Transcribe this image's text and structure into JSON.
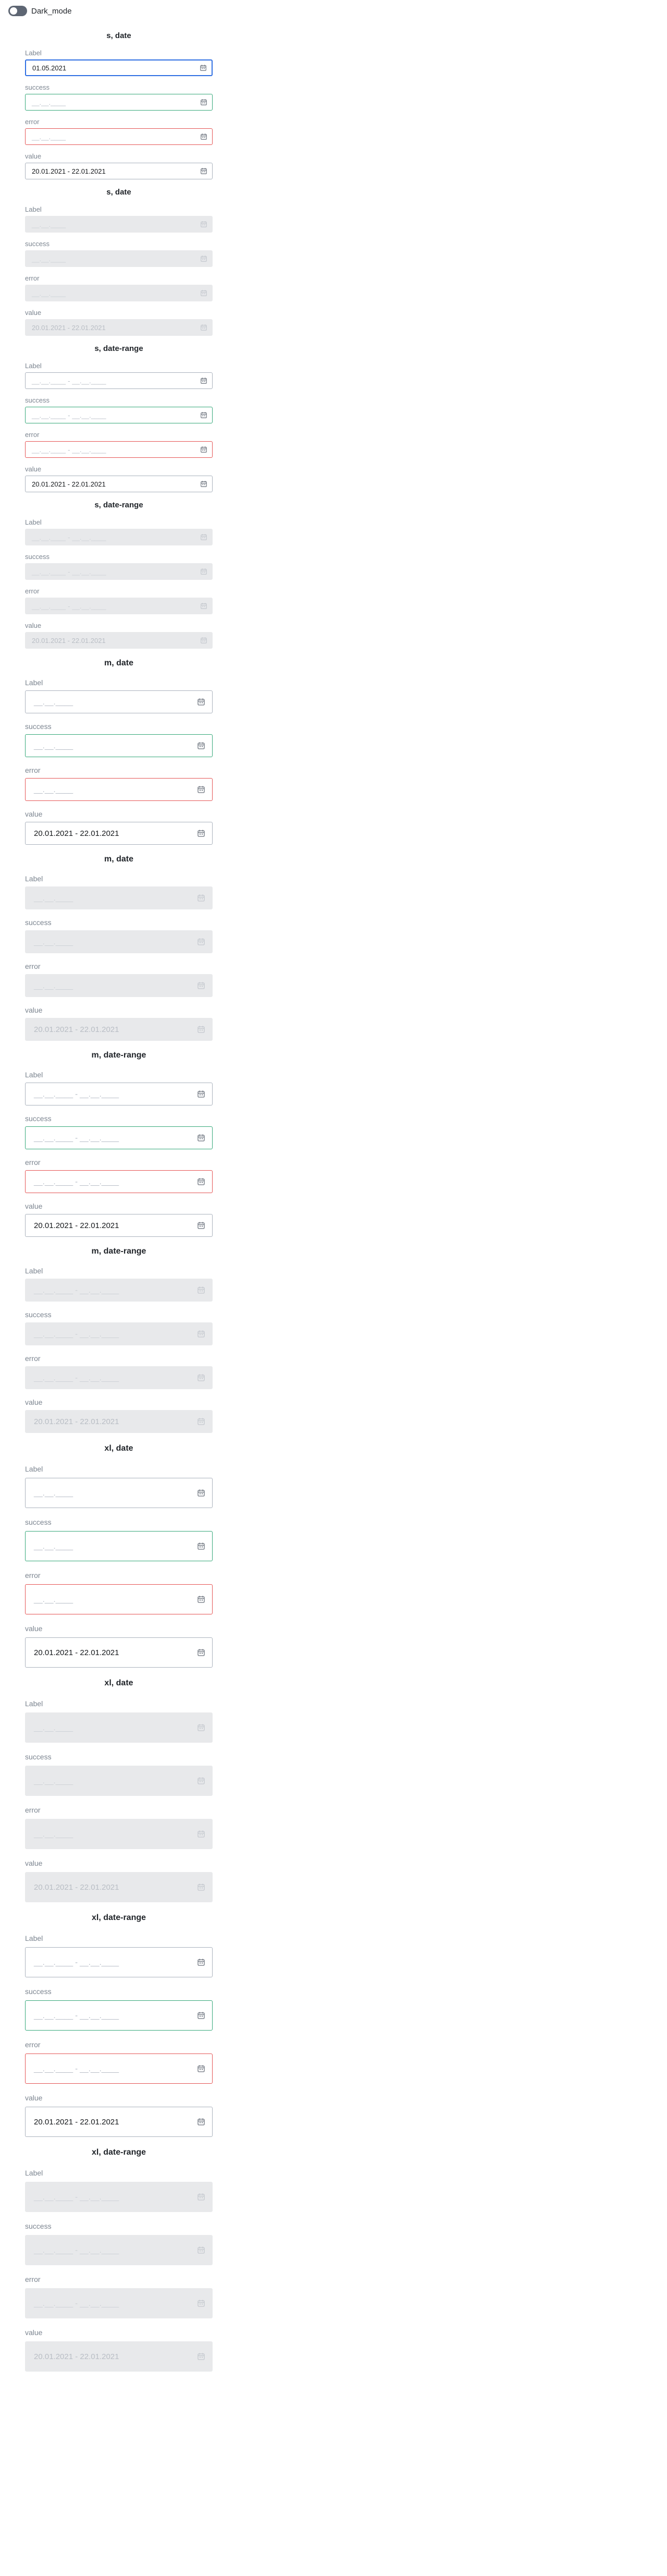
{
  "header": {
    "toggle_label": "Dark_mode",
    "toggle_on": false
  },
  "colors": {
    "focus": "#2f6fe3",
    "success": "#35a879",
    "error": "#e55454",
    "disabled_bg": "#e8e9eb",
    "label": "#7c8590"
  },
  "icons": {
    "calendar": "calendar-icon",
    "toggle": "toggle-switch"
  },
  "groups": [
    {
      "title": "s, date",
      "size": "s",
      "mode": "date",
      "disabled": false,
      "fields": [
        {
          "label": "Label",
          "status": "focused",
          "value": "01.05.2021",
          "placeholder": "__.__.____"
        },
        {
          "label": "success",
          "status": "success",
          "value": "",
          "placeholder": "__.__.____"
        },
        {
          "label": "error",
          "status": "error",
          "value": "",
          "placeholder": "__.__.____"
        },
        {
          "label": "value",
          "status": "default",
          "value": "20.01.2021 - 22.01.2021",
          "placeholder": ""
        }
      ]
    },
    {
      "title": "s, date",
      "size": "s",
      "mode": "date",
      "disabled": true,
      "fields": [
        {
          "label": "Label",
          "status": "default",
          "value": "",
          "placeholder": "__.__.____"
        },
        {
          "label": "success",
          "status": "default",
          "value": "",
          "placeholder": "__.__.____"
        },
        {
          "label": "error",
          "status": "default",
          "value": "",
          "placeholder": "__.__.____"
        },
        {
          "label": "value",
          "status": "default",
          "value": "20.01.2021 - 22.01.2021",
          "placeholder": ""
        }
      ]
    },
    {
      "title": "s, date-range",
      "size": "s",
      "mode": "range",
      "disabled": false,
      "fields": [
        {
          "label": "Label",
          "status": "default",
          "value": "",
          "placeholder": "__.__.____"
        },
        {
          "label": "success",
          "status": "success",
          "value": "",
          "placeholder": "__.__.____"
        },
        {
          "label": "error",
          "status": "error",
          "value": "",
          "placeholder": "__.__.____"
        },
        {
          "label": "value",
          "status": "default",
          "value": "20.01.2021 - 22.01.2021",
          "placeholder": ""
        }
      ]
    },
    {
      "title": "s, date-range",
      "size": "s",
      "mode": "range",
      "disabled": true,
      "fields": [
        {
          "label": "Label",
          "status": "default",
          "value": "",
          "placeholder": "__.__.____"
        },
        {
          "label": "success",
          "status": "default",
          "value": "",
          "placeholder": "__.__.____"
        },
        {
          "label": "error",
          "status": "default",
          "value": "",
          "placeholder": "__.__.____"
        },
        {
          "label": "value",
          "status": "default",
          "value": "20.01.2021 - 22.01.2021",
          "placeholder": ""
        }
      ]
    },
    {
      "title": "m, date",
      "size": "m",
      "mode": "date",
      "disabled": false,
      "fields": [
        {
          "label": "Label",
          "status": "default",
          "value": "",
          "placeholder": "__.__.____"
        },
        {
          "label": "success",
          "status": "success",
          "value": "",
          "placeholder": "__.__.____"
        },
        {
          "label": "error",
          "status": "error",
          "value": "",
          "placeholder": "__.__.____"
        },
        {
          "label": "value",
          "status": "default",
          "value": "20.01.2021 - 22.01.2021",
          "placeholder": ""
        }
      ]
    },
    {
      "title": "m, date",
      "size": "m",
      "mode": "date",
      "disabled": true,
      "fields": [
        {
          "label": "Label",
          "status": "default",
          "value": "",
          "placeholder": "__.__.____"
        },
        {
          "label": "success",
          "status": "default",
          "value": "",
          "placeholder": "__.__.____"
        },
        {
          "label": "error",
          "status": "default",
          "value": "",
          "placeholder": "__.__.____"
        },
        {
          "label": "value",
          "status": "default",
          "value": "20.01.2021 - 22.01.2021",
          "placeholder": ""
        }
      ]
    },
    {
      "title": "m, date-range",
      "size": "m",
      "mode": "range",
      "disabled": false,
      "fields": [
        {
          "label": "Label",
          "status": "default",
          "value": "",
          "placeholder": "__.__.____"
        },
        {
          "label": "success",
          "status": "success",
          "value": "",
          "placeholder": "__.__.____"
        },
        {
          "label": "error",
          "status": "error",
          "value": "",
          "placeholder": "__.__.____"
        },
        {
          "label": "value",
          "status": "default",
          "value": "20.01.2021 - 22.01.2021",
          "placeholder": ""
        }
      ]
    },
    {
      "title": "m, date-range",
      "size": "m",
      "mode": "range",
      "disabled": true,
      "fields": [
        {
          "label": "Label",
          "status": "default",
          "value": "",
          "placeholder": "__.__.____"
        },
        {
          "label": "success",
          "status": "default",
          "value": "",
          "placeholder": "__.__.____"
        },
        {
          "label": "error",
          "status": "default",
          "value": "",
          "placeholder": "__.__.____"
        },
        {
          "label": "value",
          "status": "default",
          "value": "20.01.2021 - 22.01.2021",
          "placeholder": ""
        }
      ]
    },
    {
      "title": "xl, date",
      "size": "xl",
      "mode": "date",
      "disabled": false,
      "fields": [
        {
          "label": "Label",
          "status": "default",
          "value": "",
          "placeholder": "__.__.____"
        },
        {
          "label": "success",
          "status": "success",
          "value": "",
          "placeholder": "__.__.____"
        },
        {
          "label": "error",
          "status": "error",
          "value": "",
          "placeholder": "__.__.____"
        },
        {
          "label": "value",
          "status": "default",
          "value": "20.01.2021 - 22.01.2021",
          "placeholder": ""
        }
      ]
    },
    {
      "title": "xl, date",
      "size": "xl",
      "mode": "date",
      "disabled": true,
      "fields": [
        {
          "label": "Label",
          "status": "default",
          "value": "",
          "placeholder": "__.__.____"
        },
        {
          "label": "success",
          "status": "default",
          "value": "",
          "placeholder": "__.__.____"
        },
        {
          "label": "error",
          "status": "default",
          "value": "",
          "placeholder": "__.__.____"
        },
        {
          "label": "value",
          "status": "default",
          "value": "20.01.2021 - 22.01.2021",
          "placeholder": ""
        }
      ]
    },
    {
      "title": "xl, date-range",
      "size": "xl",
      "mode": "range",
      "disabled": false,
      "fields": [
        {
          "label": "Label",
          "status": "default",
          "value": "",
          "placeholder": "__.__.____"
        },
        {
          "label": "success",
          "status": "success",
          "value": "",
          "placeholder": "__.__.____"
        },
        {
          "label": "error",
          "status": "error",
          "value": "",
          "placeholder": "__.__.____"
        },
        {
          "label": "value",
          "status": "default",
          "value": "20.01.2021 - 22.01.2021",
          "placeholder": ""
        }
      ]
    },
    {
      "title": "xl, date-range",
      "size": "xl",
      "mode": "range",
      "disabled": true,
      "fields": [
        {
          "label": "Label",
          "status": "default",
          "value": "",
          "placeholder": "__.__.____"
        },
        {
          "label": "success",
          "status": "default",
          "value": "",
          "placeholder": "__.__.____"
        },
        {
          "label": "error",
          "status": "default",
          "value": "",
          "placeholder": "__.__.____"
        },
        {
          "label": "value",
          "status": "default",
          "value": "20.01.2021 - 22.01.2021",
          "placeholder": ""
        }
      ]
    }
  ]
}
